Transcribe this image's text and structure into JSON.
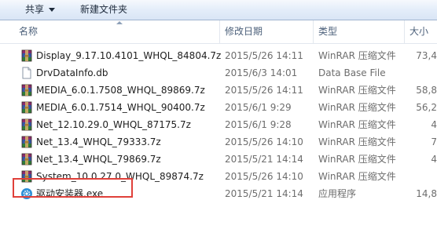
{
  "toolbar": {
    "share_label": "共享",
    "new_folder_label": "新建文件夹"
  },
  "columns": {
    "name": "名称",
    "date": "修改日期",
    "type": "类型",
    "size": "大小"
  },
  "files": [
    {
      "name": "Display_9.17.10.4101_WHQL_84804.7z",
      "date": "2015/5/26 14:11",
      "type": "WinRAR 压缩文件",
      "size": "73,4",
      "icon": "winrar-archive-icon"
    },
    {
      "name": "DrvDataInfo.db",
      "date": "2015/6/3 14:01",
      "type": "Data Base File",
      "size": "",
      "icon": "generic-file-icon"
    },
    {
      "name": "MEDIA_6.0.1.7508_WHQL_89869.7z",
      "date": "2015/5/26 14:11",
      "type": "WinRAR 压缩文件",
      "size": "58,8",
      "icon": "winrar-archive-icon"
    },
    {
      "name": "MEDIA_6.0.1.7514_WHQL_90400.7z",
      "date": "2015/6/1 9:29",
      "type": "WinRAR 压缩文件",
      "size": "56,2",
      "icon": "winrar-archive-icon"
    },
    {
      "name": "Net_12.10.29.0_WHQL_87175.7z",
      "date": "2015/6/1 9:28",
      "type": "WinRAR 压缩文件",
      "size": "4",
      "icon": "winrar-archive-icon"
    },
    {
      "name": "Net_13.4_WHQL_79333.7z",
      "date": "2015/5/26 14:10",
      "type": "WinRAR 压缩文件",
      "size": "7",
      "icon": "winrar-archive-icon"
    },
    {
      "name": "Net_13.4_WHQL_79869.7z",
      "date": "2015/5/21 14:14",
      "type": "WinRAR 压缩文件",
      "size": "4",
      "icon": "winrar-archive-icon"
    },
    {
      "name": "System_10.0.27.0_WHQL_89874.7z",
      "date": "2015/5/26 14:10",
      "type": "WinRAR 压缩文件",
      "size": "",
      "icon": "winrar-archive-icon"
    },
    {
      "name": "驱动安装器.exe",
      "date": "2015/5/21 14:14",
      "type": "应用程序",
      "size": "14,8",
      "icon": "gear-app-icon"
    }
  ],
  "colors": {
    "highlight_border": "#e0403a",
    "toolbar_top": "#f6f9fd",
    "toolbar_bottom": "#d9e5f5"
  }
}
